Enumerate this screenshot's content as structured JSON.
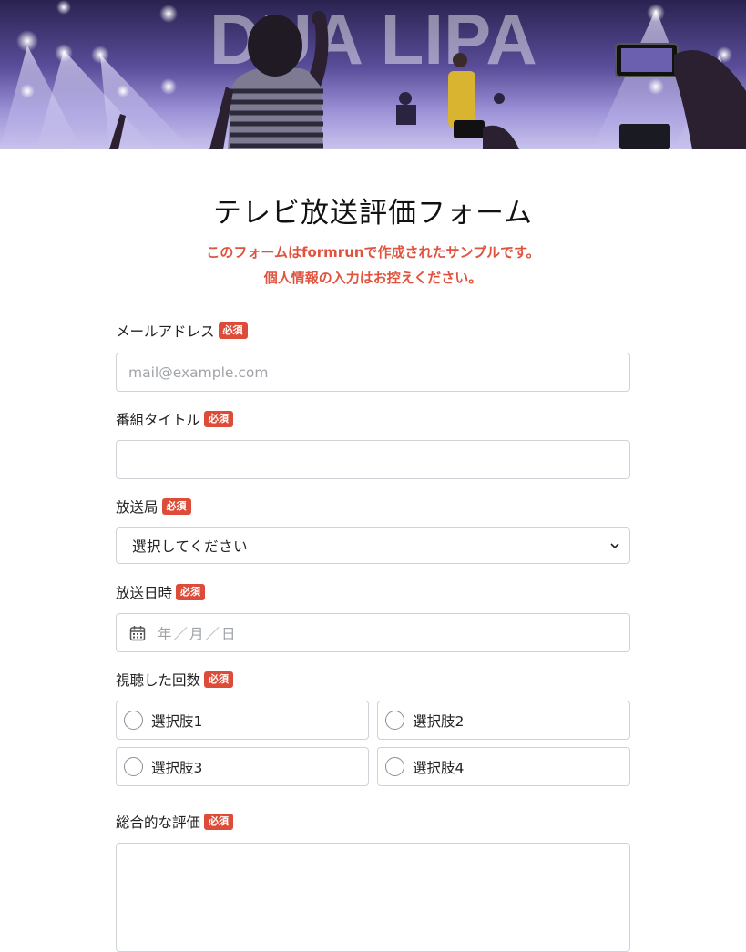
{
  "header_image": {
    "description_icon": "concert-stage-photo"
  },
  "form": {
    "title": "テレビ放送評価フォーム",
    "note_line1": "このフォームはformrunで作成されたサンプルです。",
    "note_line2": "個人情報の入力はお控えください。",
    "required_badge": "必須",
    "fields": {
      "email": {
        "label": "メールアドレス",
        "placeholder": "mail@example.com"
      },
      "program_title": {
        "label": "番組タイトル",
        "value": ""
      },
      "station": {
        "label": "放送局",
        "selected": "選択してください"
      },
      "air_date": {
        "label": "放送日時",
        "placeholder": "年／月／日"
      },
      "view_count": {
        "label": "視聴した回数",
        "options": [
          "選択肢1",
          "選択肢2",
          "選択肢3",
          "選択肢4"
        ]
      },
      "overall": {
        "label": "総合的な評価",
        "value": ""
      }
    }
  },
  "colors": {
    "accent_red": "#dd4b39",
    "note_red": "#e0533f",
    "border": "#cfd3d8"
  }
}
